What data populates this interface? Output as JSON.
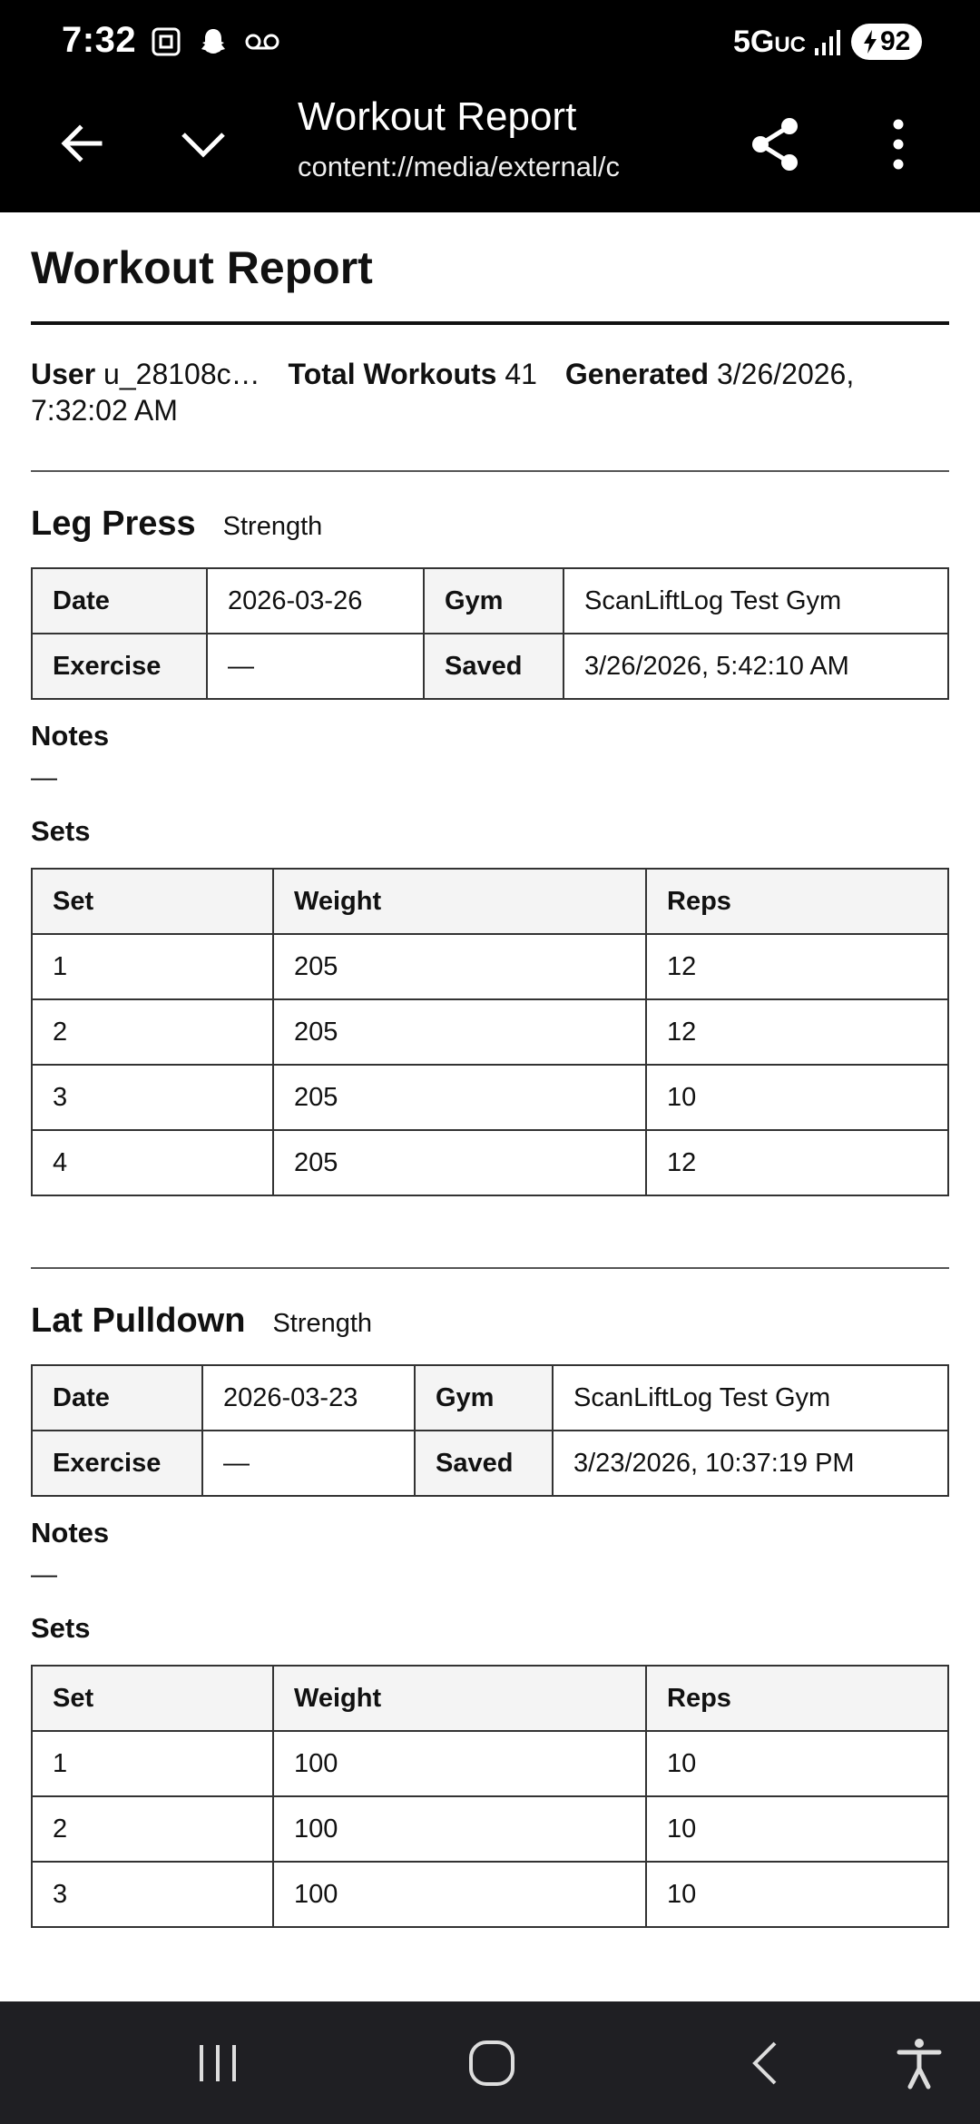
{
  "status_bar": {
    "time": "7:32",
    "network": "5G",
    "network_suffix": "UC",
    "battery": "92"
  },
  "app_bar": {
    "title": "Workout Report",
    "url": "content://media/external/c"
  },
  "report": {
    "title": "Workout Report",
    "meta": {
      "user_label": "User",
      "user_value": "u_28108c…",
      "total_label": "Total Workouts",
      "total_value": "41",
      "generated_label": "Generated",
      "generated_value": "3/26/2026, 7:32:02 AM"
    },
    "labels": {
      "date": "Date",
      "gym": "Gym",
      "exercise": "Exercise",
      "saved": "Saved",
      "notes": "Notes",
      "sets": "Sets",
      "set_col": "Set",
      "weight_col": "Weight",
      "reps_col": "Reps"
    },
    "exercises": [
      {
        "name": "Leg Press",
        "category": "Strength",
        "date": "2026-03-26",
        "gym": "ScanLiftLog Test Gym",
        "exercise": "—",
        "saved": "3/26/2026, 5:42:10 AM",
        "notes": "—",
        "sets": [
          {
            "set": "1",
            "weight": "205",
            "reps": "12"
          },
          {
            "set": "2",
            "weight": "205",
            "reps": "12"
          },
          {
            "set": "3",
            "weight": "205",
            "reps": "10"
          },
          {
            "set": "4",
            "weight": "205",
            "reps": "12"
          }
        ]
      },
      {
        "name": "Lat Pulldown",
        "category": "Strength",
        "date": "2026-03-23",
        "gym": "ScanLiftLog Test Gym",
        "exercise": "—",
        "saved": "3/23/2026, 10:37:19 PM",
        "notes": "—",
        "sets": [
          {
            "set": "1",
            "weight": "100",
            "reps": "10"
          },
          {
            "set": "2",
            "weight": "100",
            "reps": "10"
          },
          {
            "set": "3",
            "weight": "100",
            "reps": "10"
          }
        ]
      }
    ]
  }
}
